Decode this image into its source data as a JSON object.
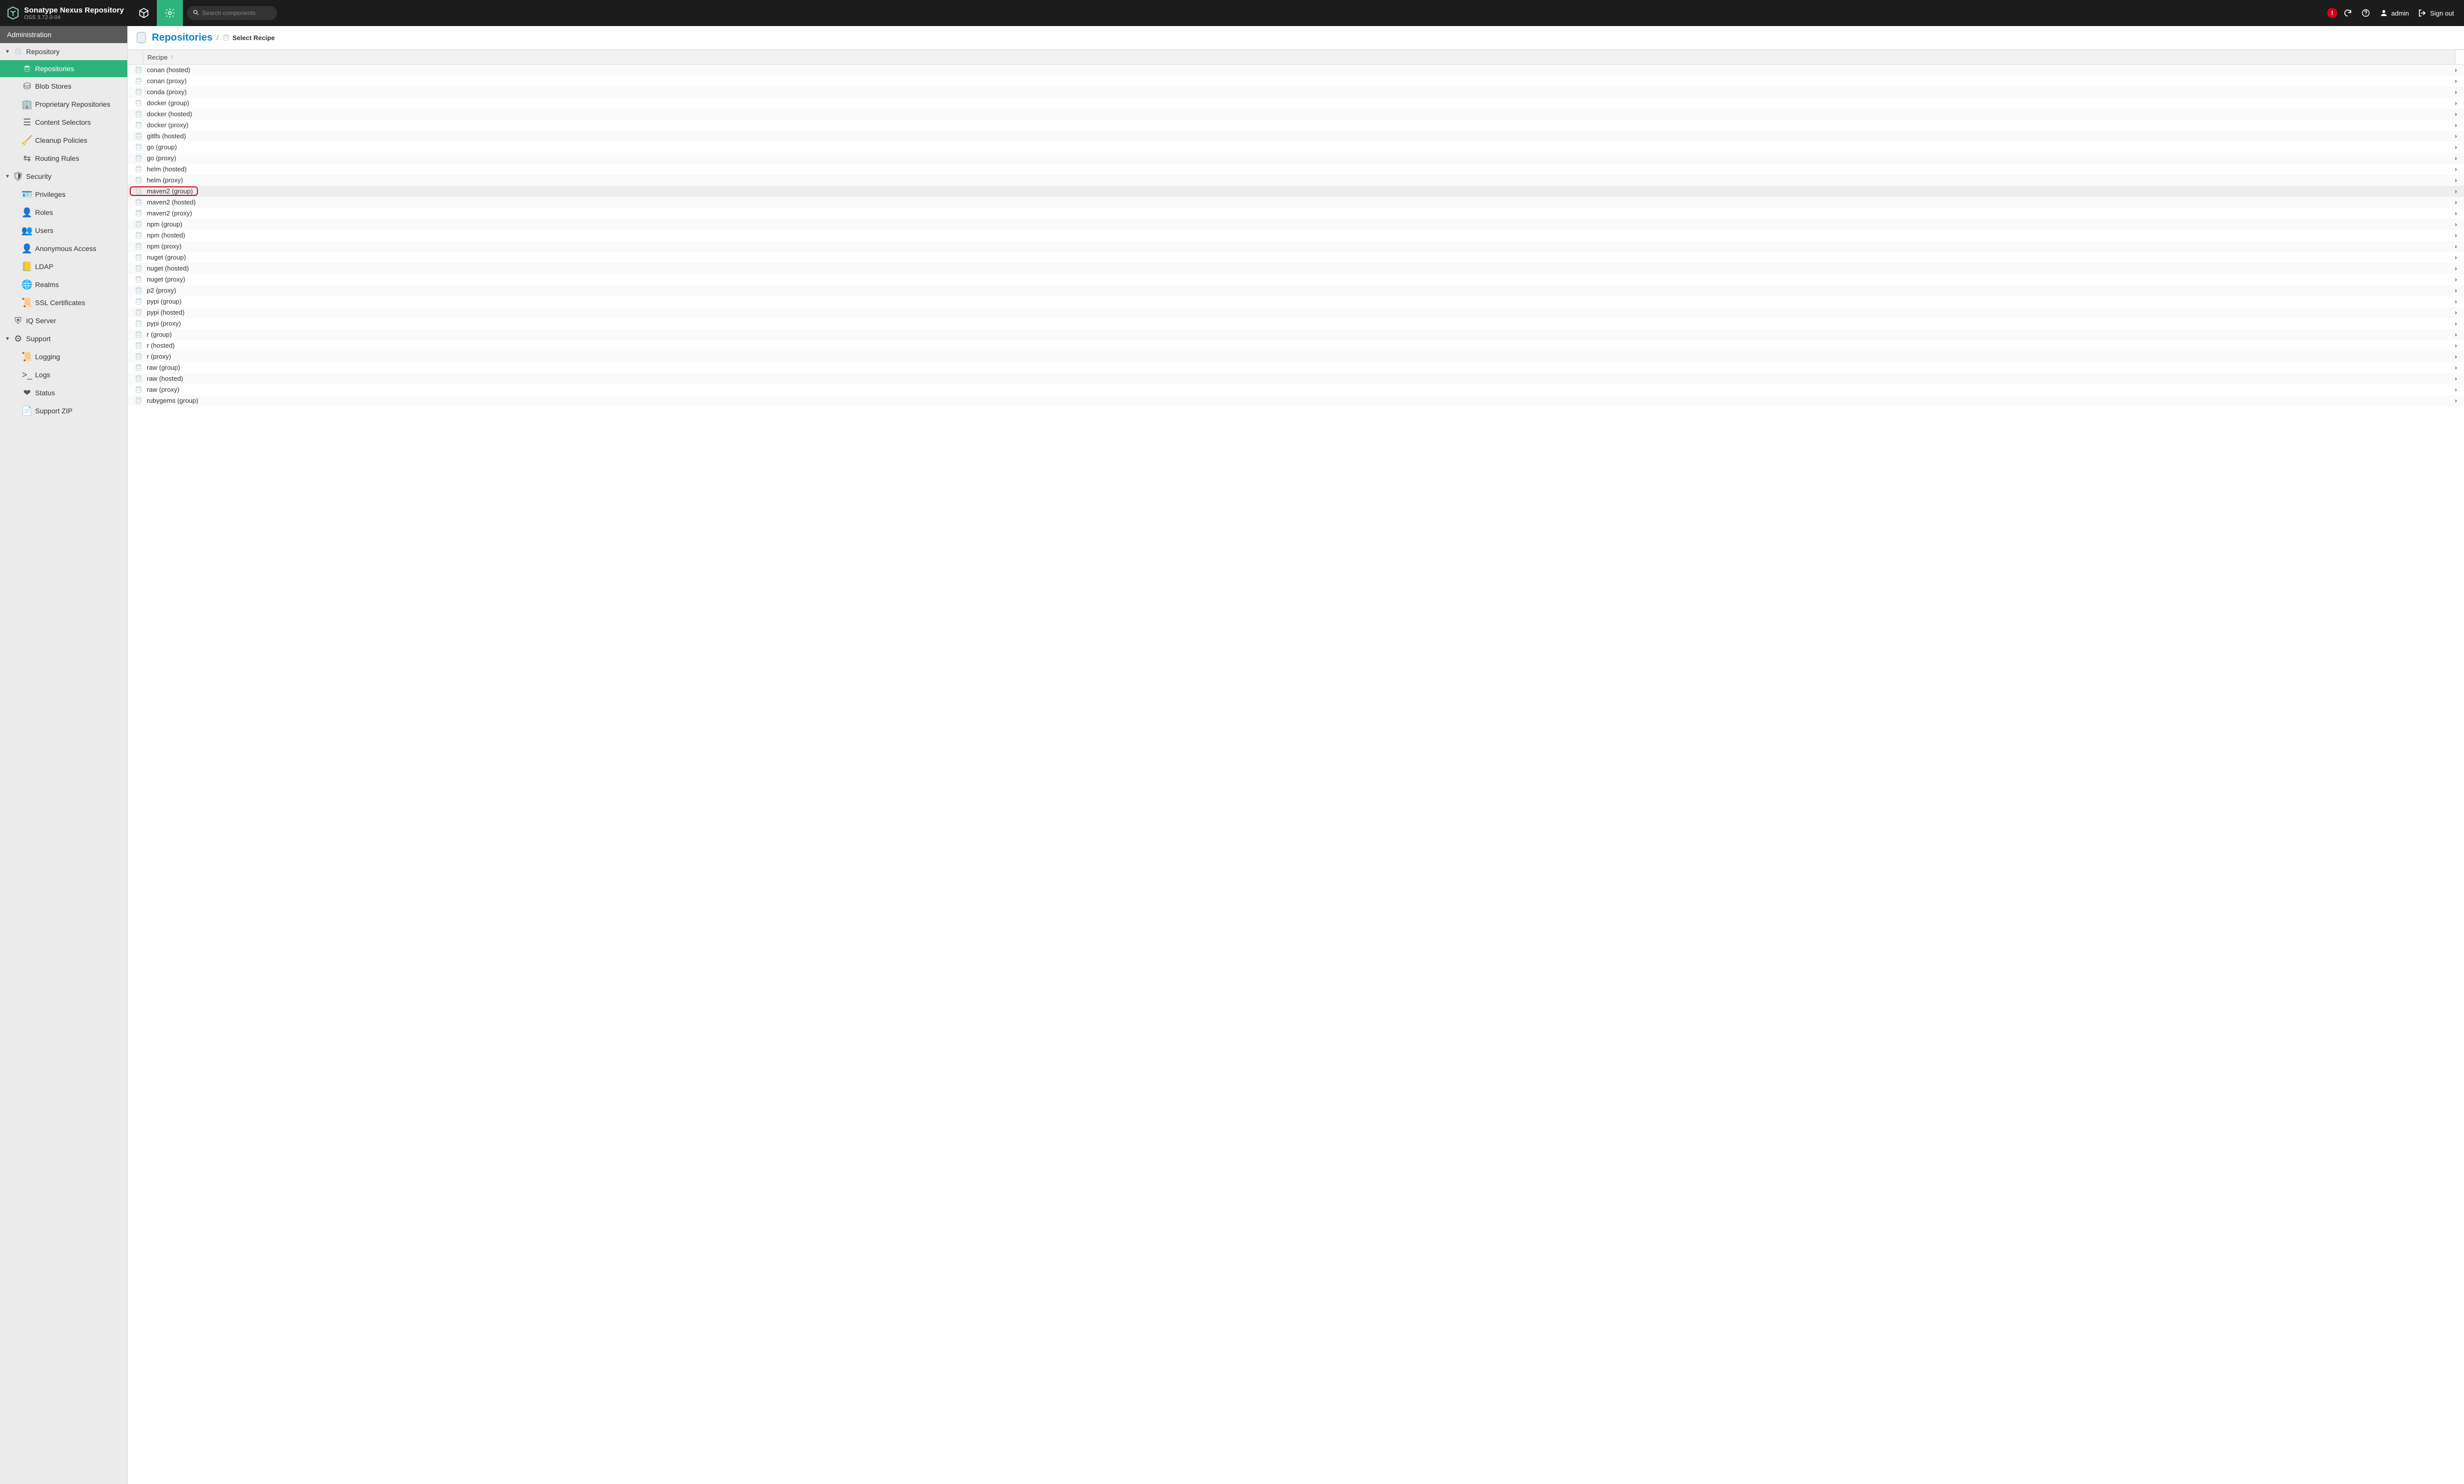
{
  "header": {
    "product_title": "Sonatype Nexus Repository",
    "product_sub": "OSS 3.72.0-04",
    "search_placeholder": "Search components",
    "username": "admin",
    "signout": "Sign out"
  },
  "sidebar": {
    "title": "Administration",
    "sections": [
      {
        "label": "Repository",
        "icon": "db",
        "expanded": true,
        "children": [
          {
            "label": "Repositories",
            "icon": "db",
            "selected": true
          },
          {
            "label": "Blob Stores",
            "icon": "harddrive"
          },
          {
            "label": "Proprietary Repositories",
            "icon": "building"
          },
          {
            "label": "Content Selectors",
            "icon": "layers"
          },
          {
            "label": "Cleanup Policies",
            "icon": "broom"
          },
          {
            "label": "Routing Rules",
            "icon": "route"
          }
        ]
      },
      {
        "label": "Security",
        "icon": "shield",
        "expanded": true,
        "children": [
          {
            "label": "Privileges",
            "icon": "id-badge"
          },
          {
            "label": "Roles",
            "icon": "user-tag"
          },
          {
            "label": "Users",
            "icon": "users"
          },
          {
            "label": "Anonymous Access",
            "icon": "user"
          },
          {
            "label": "LDAP",
            "icon": "book"
          },
          {
            "label": "Realms",
            "icon": "globe"
          },
          {
            "label": "SSL Certificates",
            "icon": "certificate"
          }
        ]
      },
      {
        "label": "IQ Server",
        "icon": "shield-alt",
        "expanded": false,
        "children": []
      },
      {
        "label": "Support",
        "icon": "lifebuoy",
        "expanded": true,
        "children": [
          {
            "label": "Logging",
            "icon": "scroll"
          },
          {
            "label": "Logs",
            "icon": "terminal"
          },
          {
            "label": "Status",
            "icon": "heartbeat"
          },
          {
            "label": "Support ZIP",
            "icon": "file-archive"
          }
        ]
      }
    ]
  },
  "breadcrumb": {
    "main": "Repositories",
    "sub": "Select Recipe"
  },
  "grid": {
    "column_label": "Recipe",
    "sort_dir": "asc"
  },
  "recipes": [
    {
      "label": "conan (hosted)"
    },
    {
      "label": "conan (proxy)"
    },
    {
      "label": "conda (proxy)"
    },
    {
      "label": "docker (group)"
    },
    {
      "label": "docker (hosted)"
    },
    {
      "label": "docker (proxy)"
    },
    {
      "label": "gitlfs (hosted)"
    },
    {
      "label": "go (group)"
    },
    {
      "label": "go (proxy)"
    },
    {
      "label": "helm (hosted)"
    },
    {
      "label": "helm (proxy)"
    },
    {
      "label": "maven2 (group)",
      "highlight": true
    },
    {
      "label": "maven2 (hosted)"
    },
    {
      "label": "maven2 (proxy)"
    },
    {
      "label": "npm (group)"
    },
    {
      "label": "npm (hosted)"
    },
    {
      "label": "npm (proxy)"
    },
    {
      "label": "nuget (group)"
    },
    {
      "label": "nuget (hosted)"
    },
    {
      "label": "nuget (proxy)"
    },
    {
      "label": "p2 (proxy)"
    },
    {
      "label": "pypi (group)"
    },
    {
      "label": "pypi (hosted)"
    },
    {
      "label": "pypi (proxy)"
    },
    {
      "label": "r (group)"
    },
    {
      "label": "r (hosted)"
    },
    {
      "label": "r (proxy)"
    },
    {
      "label": "raw (group)"
    },
    {
      "label": "raw (hosted)"
    },
    {
      "label": "raw (proxy)"
    },
    {
      "label": "rubygems (group)"
    }
  ],
  "icon_map": {
    "harddrive": "⛁",
    "building": "🏢",
    "layers": "☰",
    "broom": "🧹",
    "route": "⇆",
    "shield": "🛡",
    "id-badge": "🪪",
    "user-tag": "👤",
    "users": "👥",
    "user": "👤",
    "book": "📒",
    "globe": "🌐",
    "certificate": "📜",
    "shield-alt": "⛨",
    "lifebuoy": "⚙",
    "scroll": "📜",
    "terminal": ">_",
    "heartbeat": "❤",
    "file-archive": "📄"
  }
}
